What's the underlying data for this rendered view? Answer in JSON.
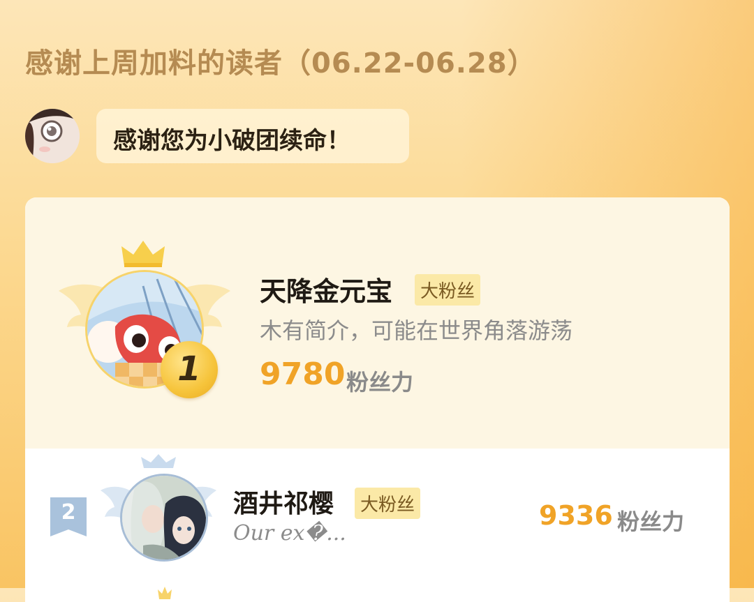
{
  "header": {
    "title": "感谢上周加料的读者（06.22-06.28）"
  },
  "message": {
    "text": "感谢您为小破团续命！"
  },
  "ranking": [
    {
      "rank": "1",
      "name": "天降金元宝",
      "tag": "大粉丝",
      "description": "木有简介，可能在世界角落游荡",
      "score": "9780",
      "score_unit": "粉丝力"
    },
    {
      "rank": "2",
      "name": "酒井祁樱",
      "tag": "大粉丝",
      "description": "Our ex�...",
      "score": "9336",
      "score_unit": "粉丝力"
    }
  ],
  "colors": {
    "accent": "#f0a327",
    "background_top": "#fde6b8",
    "background_bottom": "#f9c463",
    "card_first_bg": "#fdf6e3",
    "tag_bg": "#fbe9a7"
  },
  "icons": {
    "crown": "crown-icon",
    "wings": "wings-icon",
    "rank_flag": "rank-flag-icon"
  }
}
